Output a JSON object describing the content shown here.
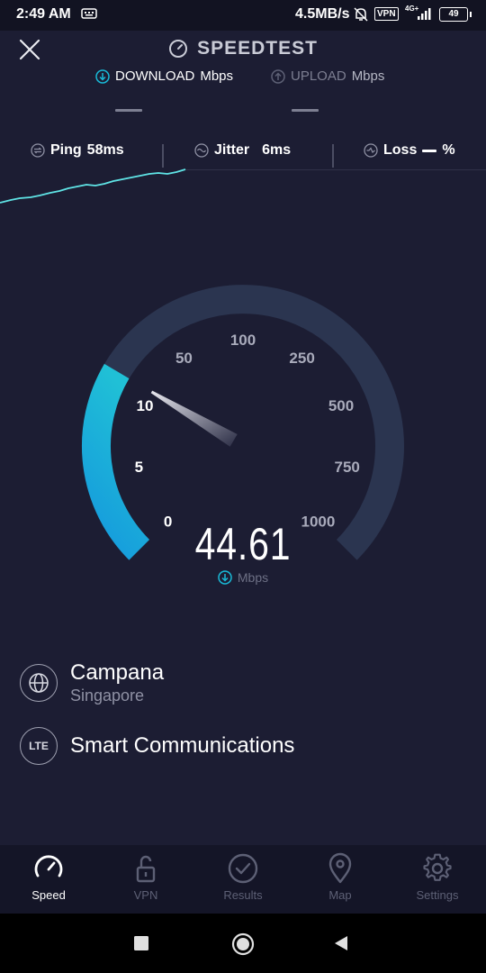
{
  "status_bar": {
    "time": "2:49 AM",
    "net_speed": "4.5MB/s",
    "vpn_label": "VPN",
    "network": "4G+",
    "battery": "49"
  },
  "header": {
    "title": "SPEEDTEST",
    "tabs": {
      "download_label": "DOWNLOAD",
      "download_unit": "Mbps",
      "upload_label": "UPLOAD",
      "upload_unit": "Mbps"
    }
  },
  "metrics": {
    "ping_label": "Ping",
    "ping_value": "58ms",
    "jitter_label": "Jitter",
    "jitter_value": "6ms",
    "loss_label": "Loss",
    "loss_unit": "%"
  },
  "gauge": {
    "ticks": [
      "0",
      "5",
      "10",
      "50",
      "100",
      "250",
      "500",
      "750",
      "1000"
    ],
    "current_speed": "44.61",
    "unit": "Mbps",
    "fill_fraction": 0.28,
    "accent_color": "#19b9d6",
    "track_color": "#2b3550"
  },
  "server": {
    "host_name": "Campana",
    "host_location": "Singapore",
    "isp_badge": "LTE",
    "isp_name": "Smart Communications"
  },
  "nav": {
    "items": [
      {
        "label": "Speed",
        "icon": "speedometer-icon"
      },
      {
        "label": "VPN",
        "icon": "unlock-icon"
      },
      {
        "label": "Results",
        "icon": "check-circle-icon"
      },
      {
        "label": "Map",
        "icon": "map-pin-icon"
      },
      {
        "label": "Settings",
        "icon": "gear-icon"
      }
    ]
  }
}
